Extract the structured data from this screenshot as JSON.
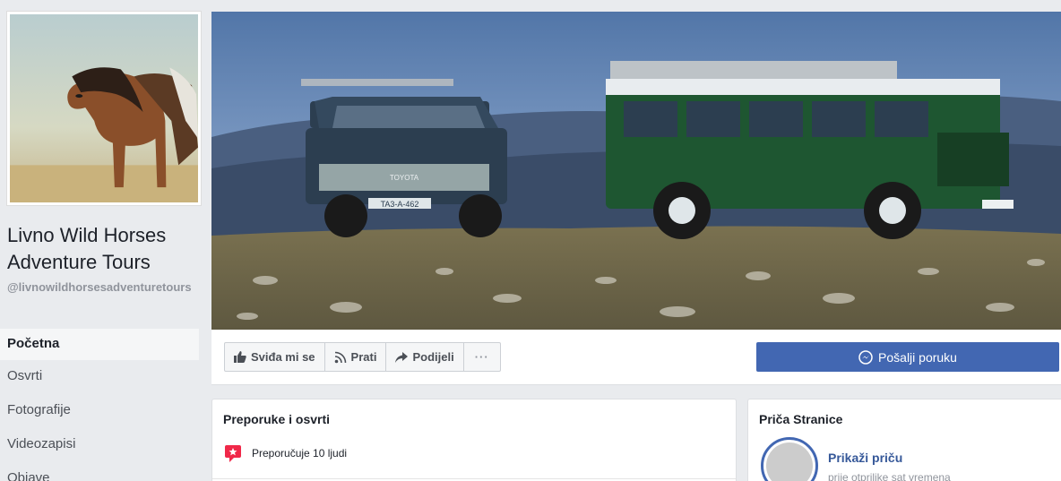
{
  "page": {
    "name": "Livno Wild Horses Adventure Tours",
    "handle": "@livnowildhorsesadventuretours"
  },
  "nav": {
    "items": [
      {
        "label": "Početna",
        "active": true
      },
      {
        "label": "Osvrti"
      },
      {
        "label": "Fotografije"
      },
      {
        "label": "Videozapisi"
      },
      {
        "label": "Objave"
      }
    ]
  },
  "actions": {
    "like_label": "Sviđa mi se",
    "follow_label": "Prati",
    "share_label": "Podijeli",
    "more_label": "···",
    "message_label": "Pošalji poruku"
  },
  "reviews": {
    "title": "Preporuke i osvrti",
    "recommend_text": "Preporučuje 10 ljudi"
  },
  "story": {
    "title": "Priča Stranice",
    "link_label": "Prikaži priču",
    "time_text": "prije otprilike sat vremena"
  },
  "cover": {
    "plate_left": "TA3-A-462",
    "brand_left": "TOYOTA"
  },
  "colors": {
    "primary": "#4267b2",
    "link": "#365899",
    "background": "#e9ebee",
    "recommend_badge": "#f02849"
  }
}
